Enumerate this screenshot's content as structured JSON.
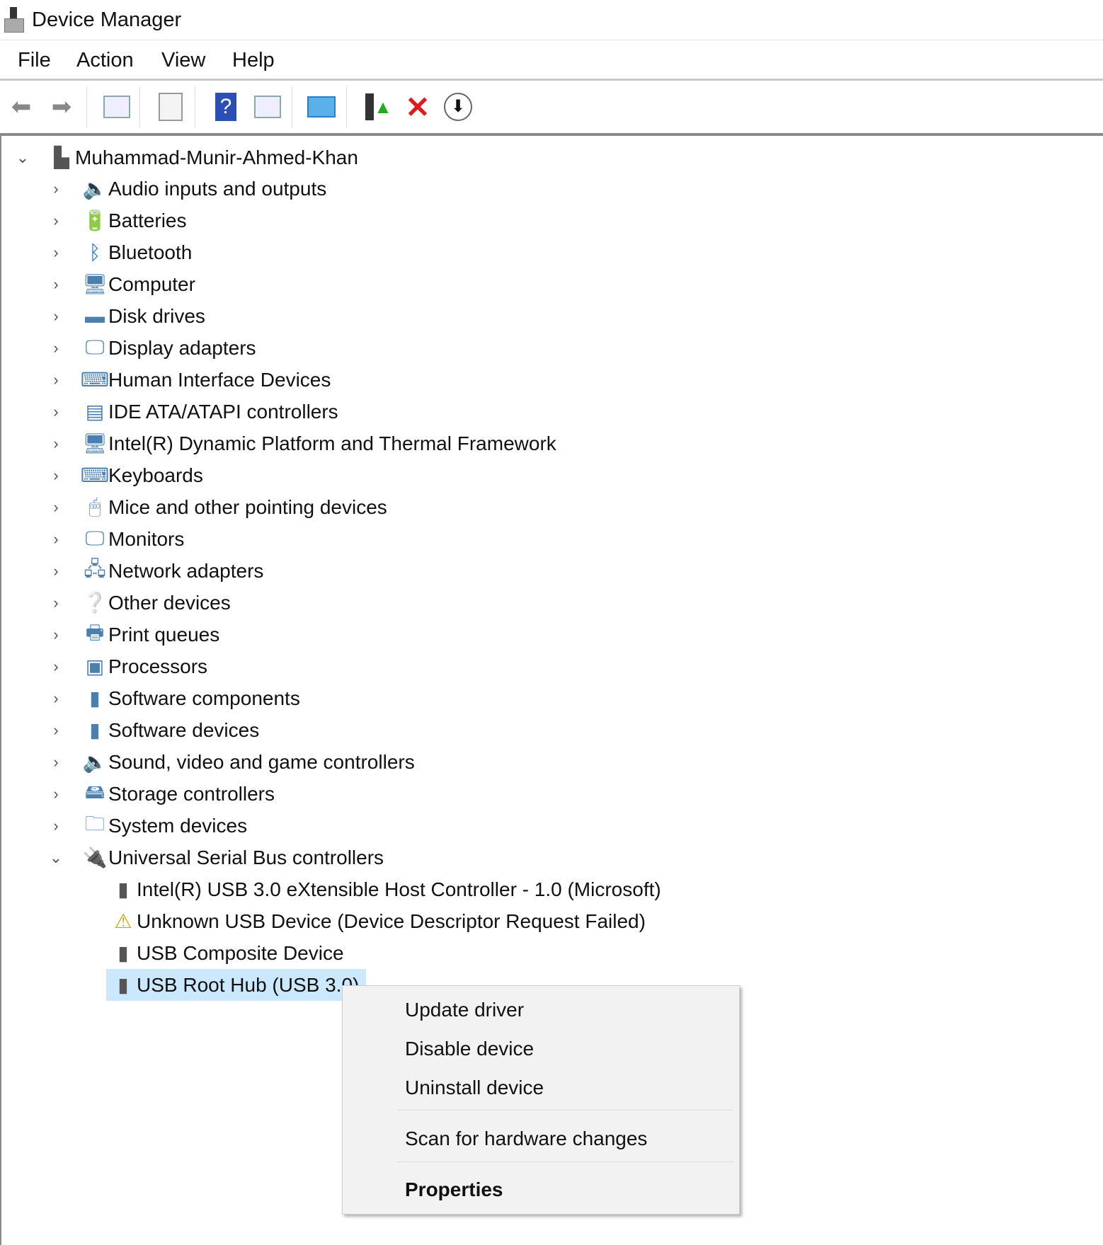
{
  "window": {
    "title": "Device Manager"
  },
  "menu": [
    "File",
    "Action",
    "View",
    "Help"
  ],
  "toolbar": [
    "back-icon",
    "forward-icon",
    "show-hide-console-tree-icon",
    "properties-icon",
    "help-icon",
    "show-hide-action-pane-icon",
    "scan-hardware-icon",
    "update-driver-icon",
    "uninstall-icon",
    "disable-device-icon"
  ],
  "tree": {
    "root": "Muhammad-Munir-Ahmed-Khan",
    "categories": [
      "Audio inputs and outputs",
      "Batteries",
      "Bluetooth",
      "Computer",
      "Disk drives",
      "Display adapters",
      "Human Interface Devices",
      "IDE ATA/ATAPI controllers",
      "Intel(R) Dynamic Platform and Thermal Framework",
      "Keyboards",
      "Mice and other pointing devices",
      "Monitors",
      "Network adapters",
      "Other devices",
      "Print queues",
      "Processors",
      "Software components",
      "Software devices",
      "Sound, video and game controllers",
      "Storage controllers",
      "System devices",
      "Universal Serial Bus controllers"
    ],
    "usb_children": [
      "Intel(R) USB 3.0 eXtensible Host Controller - 1.0 (Microsoft)",
      "Unknown USB Device (Device Descriptor Request Failed)",
      "USB Composite Device",
      "USB Root Hub (USB 3.0)"
    ],
    "selected": "USB Root Hub (USB 3.0)",
    "selection_color": "#cce8ff"
  },
  "context_menu": {
    "update": "Update driver",
    "disable": "Disable device",
    "uninstall": "Uninstall device",
    "scan": "Scan for hardware changes",
    "properties": "Properties"
  }
}
